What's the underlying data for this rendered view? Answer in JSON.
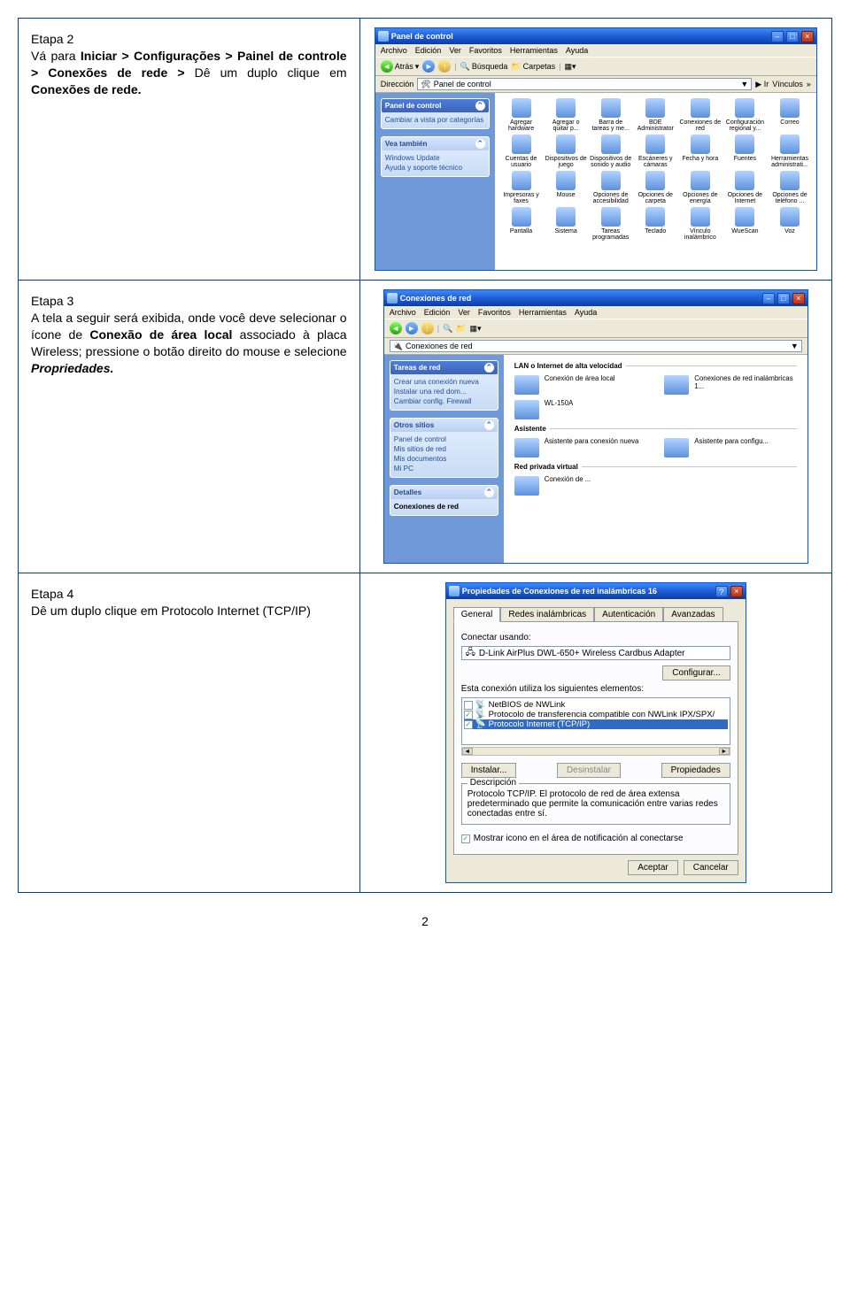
{
  "page_number": "2",
  "steps": {
    "s2": {
      "title": "Etapa 2",
      "p1": "Vá para ",
      "p2": "Iniciar > Configurações > Painel de controle > Conexões de rede > ",
      "p3": "Dê um duplo clique em ",
      "p4": "Conexões de rede."
    },
    "s3": {
      "title": "Etapa 3",
      "p1": "A tela a seguir será exibida, onde você deve selecionar o ícone de ",
      "p2": "Conexão de área local",
      "p3": " associado à placa Wireless; pressione o botão direito do mouse e selecione ",
      "p4": "Propriedades."
    },
    "s4": {
      "title": "Etapa 4",
      "p1": "Dê um duplo clique em Protocolo Internet (TCP/IP)"
    }
  },
  "cp": {
    "title": "Panel de control",
    "menu": [
      "Archivo",
      "Edición",
      "Ver",
      "Favoritos",
      "Herramientas",
      "Ayuda"
    ],
    "back": "Atrás",
    "search": "Búsqueda",
    "folders": "Carpetas",
    "addr_label": "Dirección",
    "addr": "Panel de control",
    "go": "Ir",
    "links": "Vínculos",
    "card1_title": "Panel de control",
    "card1_link": "Cambiar a vista por categorías",
    "card2_title": "Vea también",
    "card2_l1": "Windows Update",
    "card2_l2": "Ayuda y soporte técnico",
    "items": [
      "Agregar hardware",
      "Agregar o quitar p...",
      "Barra de tareas y me...",
      "BDE Administrator",
      "Conexiones de red",
      "Configuración regional y...",
      "Correo",
      "Cuentas de usuario",
      "Dispositivos de juego",
      "Dispositivos de sonido y audio",
      "Escáneres y cámaras",
      "Fecha y hora",
      "Fuentes",
      "Herramientas administrati...",
      "Impresoras y faxes",
      "Mouse",
      "Opciones de accesibilidad",
      "Opciones de carpeta",
      "Opciones de energía",
      "Opciones de Internet",
      "Opciones de teléfono ...",
      "Pantalla",
      "Sistema",
      "Tareas programadas",
      "Teclado",
      "Vínculo inalámbrico",
      "WueScan",
      "Voz"
    ]
  },
  "nc": {
    "title": "Conexiones de red",
    "sec_lan": "LAN o Internet de alta velocidad",
    "sec_wiz": "Asistente",
    "sec_virt": "Red privada virtual",
    "items": {
      "a1": "Conexión de área local",
      "a2": "Conexiones de red inalámbricas 1...",
      "b1": "Asistente para conexión nueva",
      "b2": "Asistente para configu...",
      "c1": "Conexión de ...",
      "c2": "WL-150A"
    },
    "tasks_title": "Tareas de red",
    "tasks": [
      "Crear una conexión nueva",
      "Instalar una red dom...",
      "Cambiar config. Firewall"
    ],
    "other_title": "Otros sitios",
    "other": [
      "Panel de control",
      "Mis sitios de red",
      "Mis documentos",
      "Mi PC"
    ],
    "det_title": "Detalles",
    "det": "Conexiones de red"
  },
  "dlg": {
    "title": "Propiedades de Conexiones de red inalámbricas 16",
    "tabs": [
      "General",
      "Redes inalámbricas",
      "Autenticación",
      "Avanzadas"
    ],
    "connect_using": "Conectar usando:",
    "adapter": "D-Link AirPlus DWL-650+ Wireless Cardbus Adapter",
    "configure": "Configurar...",
    "elements_label": "Esta conexión utiliza los siguientes elementos:",
    "list": {
      "l1": "NetBIOS de NWLink",
      "l2": "Protocolo de transferencia compatible con NWLink IPX/SPX/",
      "l3": "Protocolo Internet (TCP/IP)"
    },
    "install": "Instalar...",
    "uninstall": "Desinstalar",
    "properties": "Propiedades",
    "desc_label": "Descripción",
    "desc": "Protocolo TCP/IP. El protocolo de red de área extensa predeterminado que permite la comunicación entre varias redes conectadas entre sí.",
    "chk_notify": "Mostrar icono en el área de notificación al conectarse",
    "ok": "Aceptar",
    "cancel": "Cancelar"
  }
}
